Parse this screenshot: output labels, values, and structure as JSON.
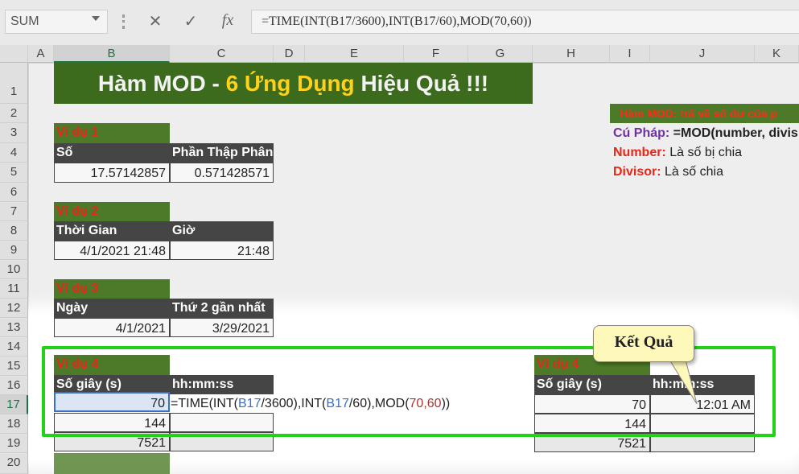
{
  "formula_bar": {
    "name_box": "SUM",
    "cancel_glyph": "✕",
    "enter_glyph": "✓",
    "fx_glyph": "fx",
    "formula": "=TIME(INT(B17/3600),INT(B17/60),MOD(70,60))"
  },
  "columns": [
    "A",
    "B",
    "C",
    "D",
    "E",
    "F",
    "G",
    "H",
    "I",
    "J",
    "K"
  ],
  "rows": [
    "1",
    "2",
    "3",
    "4",
    "5",
    "6",
    "7",
    "8",
    "9",
    "10",
    "11",
    "12",
    "13",
    "14",
    "15",
    "16",
    "17",
    "18",
    "19",
    "20"
  ],
  "title": {
    "part1": "Hàm MOD - ",
    "part2": "6 Ứng Dụng ",
    "part3": "Hiệu Quả !!!"
  },
  "side_notes": {
    "header": "Hàm MOD: trả về số dư của p",
    "syntax_label": "Cú Pháp:",
    "syntax_value": " =MOD(number, divis",
    "number_label": "Number:",
    "number_value": " Là số bị chia",
    "divisor_label": "Divisor:",
    "divisor_value": " Là số chia"
  },
  "example1": {
    "label": "Ví dụ 1",
    "h1": "Số",
    "h2": "Phần Thập Phân",
    "v1": "17.57142857",
    "v2": "0.571428571"
  },
  "example2": {
    "label": "Ví dụ 2",
    "h1": "Thời Gian",
    "h2": "Giờ",
    "v1": "4/1/2021 21:48",
    "v2": "21:48"
  },
  "example3": {
    "label": "Ví dụ 3",
    "h1": "Ngày",
    "h2": "Thứ 2 gần nhất",
    "v1": "4/1/2021",
    "v2": "3/29/2021"
  },
  "example4": {
    "label": "Ví dụ 4",
    "h1": "Số giây (s)",
    "h2": "hh:mm:ss",
    "r17": "70",
    "r18": "144",
    "r19": "7521",
    "edit_formula": {
      "p1": "=TIME(INT(",
      "ref1": "B17",
      "p2": "/3600),INT(",
      "ref2": "B17",
      "p3": "/60),MOD(",
      "n": "70,60",
      "p4": "))"
    }
  },
  "result4": {
    "label": "Ví dụ 4",
    "h1": "Số giây (s)",
    "h2": "hh:mm:ss",
    "r17": "70",
    "r17_result": "12:01 AM",
    "r18": "144",
    "r19": "7521"
  },
  "callout": "Kết Quả"
}
